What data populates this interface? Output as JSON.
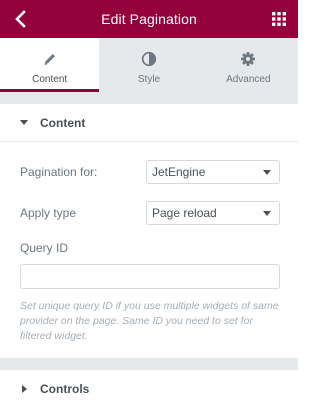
{
  "header": {
    "title": "Edit Pagination",
    "back_icon": "chevron-left-icon",
    "menu_icon": "grid-icon",
    "color": "#93003c"
  },
  "tabs": [
    {
      "label": "Content",
      "icon": "pencil-icon",
      "active": true
    },
    {
      "label": "Style",
      "icon": "half-circle-icon",
      "active": false
    },
    {
      "label": "Advanced",
      "icon": "gear-icon",
      "active": false
    }
  ],
  "content_section": {
    "title": "Content",
    "expanded": true,
    "fields": {
      "pagination_for": {
        "label": "Pagination for:",
        "value": "JetEngine"
      },
      "apply_type": {
        "label": "Apply type",
        "value": "Page reload"
      },
      "query_id": {
        "label": "Query ID",
        "value": "",
        "description": "Set unique query ID if you use multiple widgets of same provider on the page. Same ID you need to set for filtered widget."
      }
    }
  },
  "controls_section": {
    "title": "Controls",
    "expanded": false
  }
}
